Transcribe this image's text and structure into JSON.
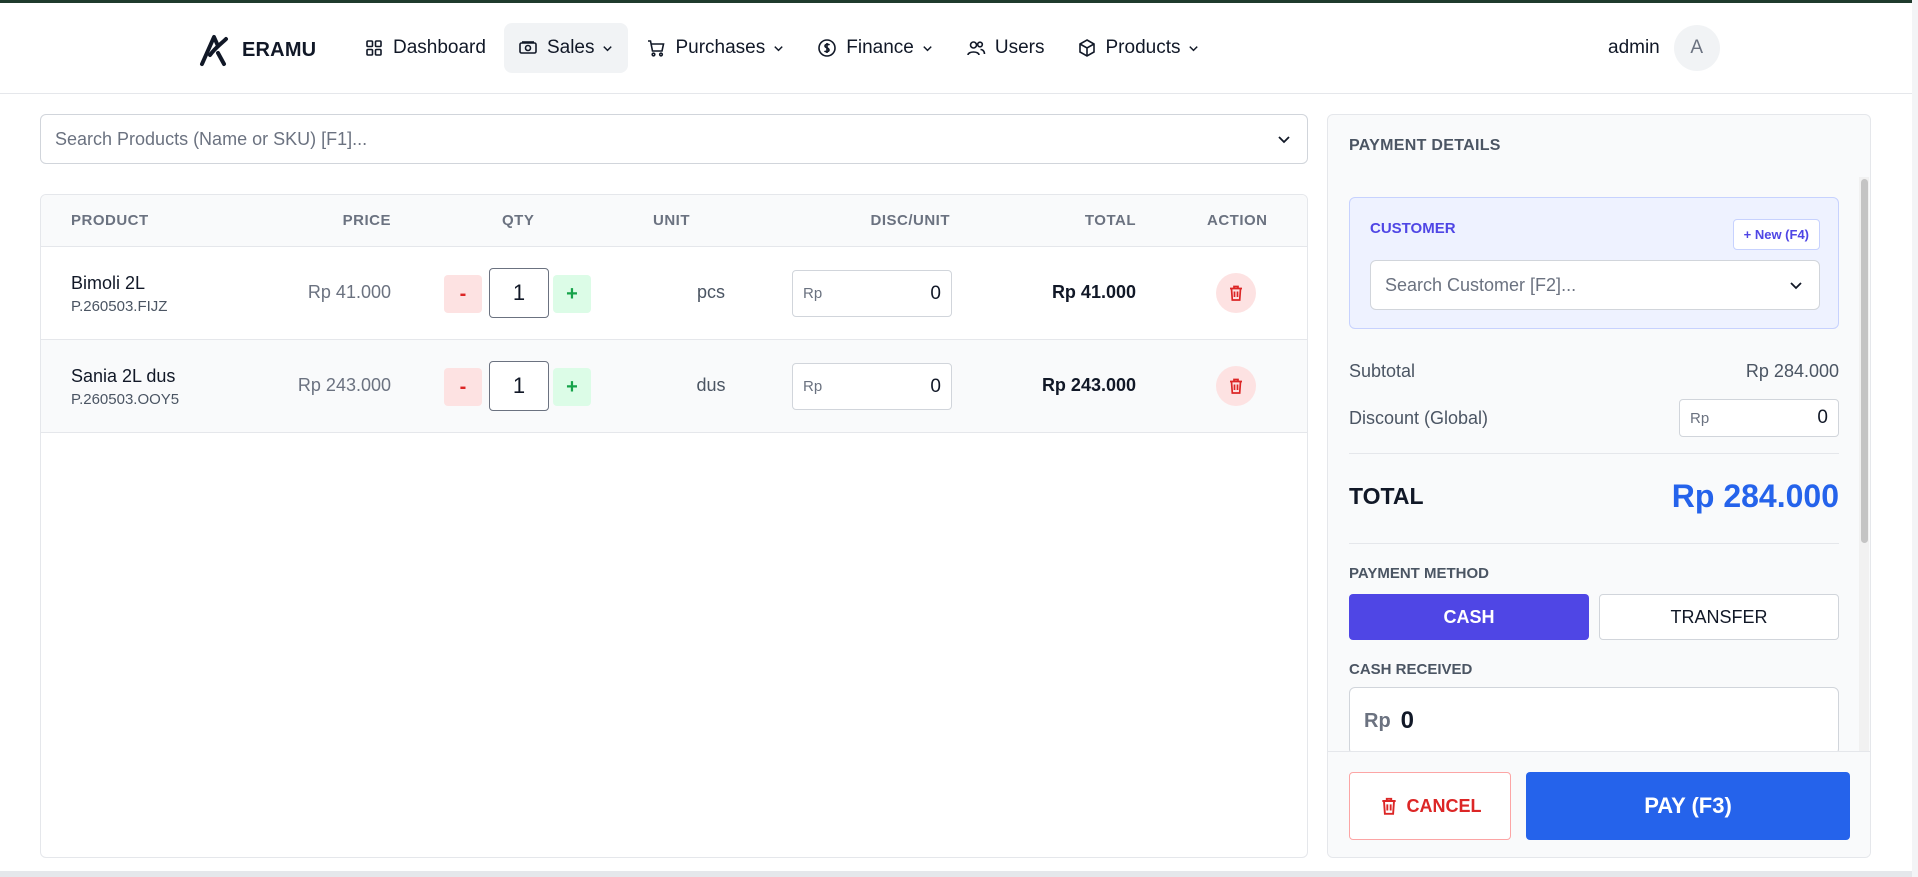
{
  "brand": {
    "name": "ERAMU"
  },
  "nav": [
    {
      "label": "Dashboard",
      "icon": "grid-icon",
      "dropdown": false
    },
    {
      "label": "Sales",
      "icon": "cash-icon",
      "dropdown": true
    },
    {
      "label": "Purchases",
      "icon": "cart-icon",
      "dropdown": true
    },
    {
      "label": "Finance",
      "icon": "dollar-circle-icon",
      "dropdown": true
    },
    {
      "label": "Users",
      "icon": "users-icon",
      "dropdown": false
    },
    {
      "label": "Products",
      "icon": "box-icon",
      "dropdown": true
    }
  ],
  "user": {
    "name": "admin",
    "initial": "A"
  },
  "search": {
    "placeholder": "Search Products (Name or SKU) [F1]..."
  },
  "table": {
    "headers": {
      "product": "PRODUCT",
      "price": "PRICE",
      "qty": "QTY",
      "unit": "UNIT",
      "disc": "DISC/UNIT",
      "total": "TOTAL",
      "action": "ACTION"
    },
    "rows": [
      {
        "name": "Bimoli 2L",
        "sku": "P.260503.FIJZ",
        "price": "Rp 41.000",
        "qty": "1",
        "unit": "pcs",
        "disc_prefix": "Rp",
        "disc": "0",
        "total": "Rp 41.000"
      },
      {
        "name": "Sania 2L dus",
        "sku": "P.260503.OOY5",
        "price": "Rp 243.000",
        "qty": "1",
        "unit": "dus",
        "disc_prefix": "Rp",
        "disc": "0",
        "total": "Rp 243.000"
      }
    ],
    "minus": "-",
    "plus": "+"
  },
  "payment": {
    "title": "PAYMENT DETAILS",
    "customer": {
      "label": "CUSTOMER",
      "new_button": "+ New (F4)",
      "placeholder": "Search Customer [F2]..."
    },
    "subtotal_label": "Subtotal",
    "subtotal": "Rp 284.000",
    "discount_label": "Discount (Global)",
    "discount_prefix": "Rp",
    "discount": "0",
    "total_label": "TOTAL",
    "total": "Rp 284.000",
    "method_label": "PAYMENT METHOD",
    "cash": "CASH",
    "transfer": "TRANSFER",
    "cash_received_label": "CASH RECEIVED",
    "cash_received_prefix": "Rp",
    "cash_received": "0",
    "cancel": "CANCEL",
    "pay": "PAY (F3)"
  },
  "colors": {
    "primary": "#2563eb",
    "indigo": "#4f46e5",
    "danger": "#dc2626",
    "success": "#16a34a"
  }
}
